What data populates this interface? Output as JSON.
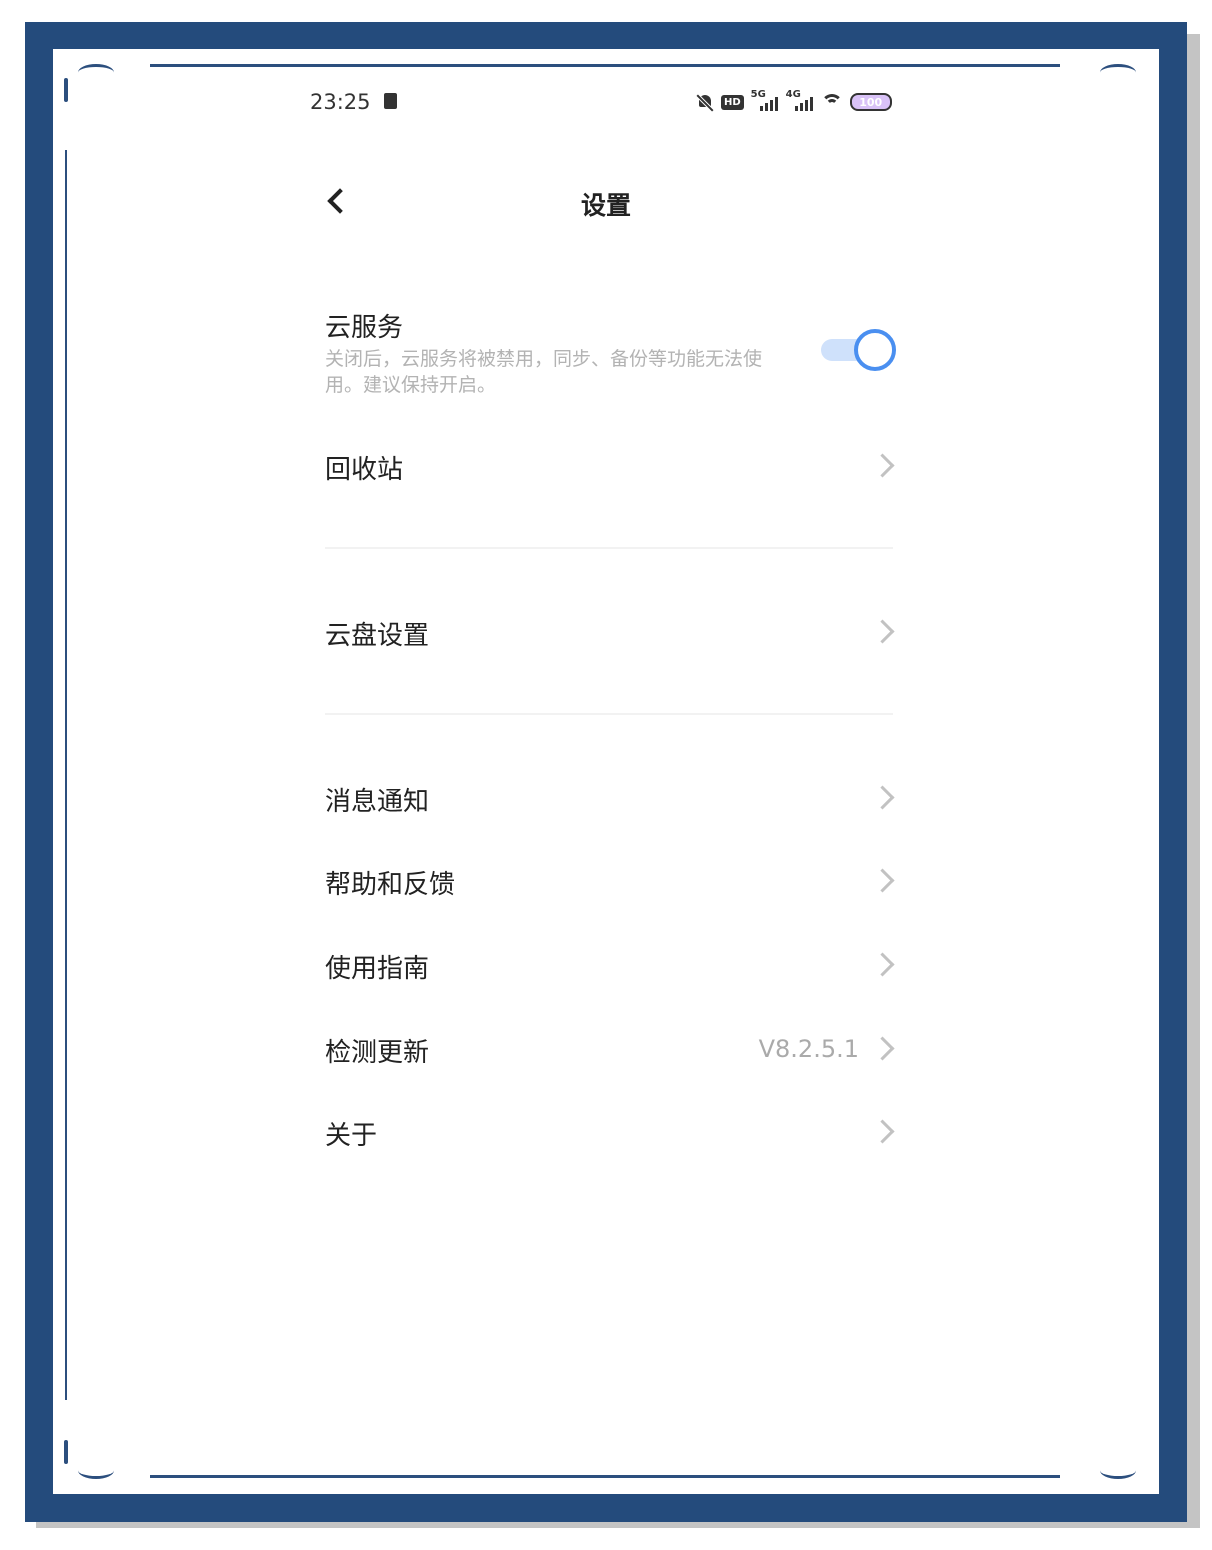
{
  "status_bar": {
    "time": "23:25",
    "hd_badge": "HD",
    "network_1": "5G",
    "network_2": "4G",
    "battery": "100"
  },
  "header": {
    "title": "设置"
  },
  "cloud_service": {
    "title": "云服务",
    "description": "关闭后，云服务将被禁用，同步、备份等功能无法使用。建议保持开启。",
    "enabled": true
  },
  "menu": {
    "recycle": {
      "label": "回收站"
    },
    "cloud_disk": {
      "label": "云盘设置"
    },
    "notifications": {
      "label": "消息通知"
    },
    "help": {
      "label": "帮助和反馈"
    },
    "guide": {
      "label": "使用指南"
    },
    "update": {
      "label": "检测更新",
      "value": "V8.2.5.1"
    },
    "about": {
      "label": "关于"
    }
  },
  "colors": {
    "accent": "#4a8ff0",
    "frame": "#244b7c"
  }
}
